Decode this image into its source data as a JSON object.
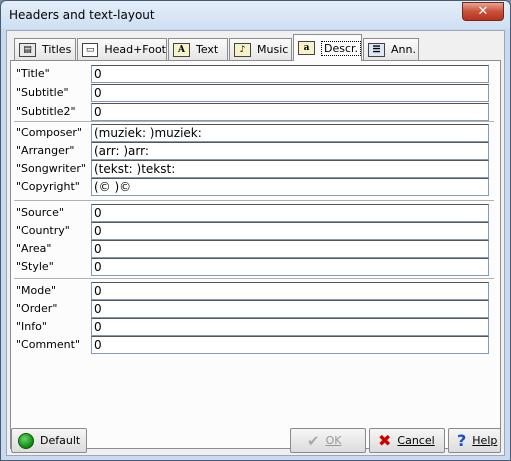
{
  "window": {
    "title": "Headers and text-layout",
    "close_symbol": "✕"
  },
  "tabs": [
    {
      "label": "Titles",
      "icon": "titles-icon"
    },
    {
      "label": "Head+Foot",
      "icon": "head-foot-icon"
    },
    {
      "label": "Text",
      "icon": "text-a-icon",
      "glyph": "A"
    },
    {
      "label": "Music",
      "icon": "music-icon",
      "glyph": "♪"
    },
    {
      "label": "Descr.",
      "icon": "descr-icon",
      "glyph": "a",
      "active": true
    },
    {
      "label": "Ann.",
      "icon": "ann-icon"
    }
  ],
  "groups": [
    {
      "rows": [
        {
          "label": "\"Title\"",
          "value": "0"
        },
        {
          "label": "\"Subtitle\"",
          "value": "0"
        },
        {
          "label": "\"Subtitle2\"",
          "value": "0"
        }
      ]
    },
    {
      "rows": [
        {
          "label": "\"Composer\"",
          "value": "(muziek: )muziek:"
        },
        {
          "label": "\"Arranger\"",
          "value": "(arr: )arr:"
        },
        {
          "label": "\"Songwriter\"",
          "value": "(tekst: )tekst:"
        },
        {
          "label": "\"Copyright\"",
          "value": "(© )©"
        }
      ]
    },
    {
      "rows": [
        {
          "label": "\"Source\"",
          "value": "0"
        },
        {
          "label": "\"Country\"",
          "value": "0"
        },
        {
          "label": "\"Area\"",
          "value": "0"
        },
        {
          "label": "\"Style\"",
          "value": "0"
        }
      ]
    },
    {
      "rows": [
        {
          "label": "\"Mode\"",
          "value": "0"
        },
        {
          "label": "\"Order\"",
          "value": "0"
        },
        {
          "label": "\"Info\"",
          "value": "0"
        },
        {
          "label": "\"Comment\"",
          "value": "0"
        }
      ]
    }
  ],
  "buttons": {
    "default_label": "Default",
    "ok_label": "OK",
    "ok_enabled": false,
    "cancel_label": "Cancel",
    "help_label": "Help"
  },
  "colors": {
    "title_bar": "#cfdff3",
    "close_button": "#c9503a",
    "default_icon": "#0c8a0c",
    "cancel_icon": "#cc0000",
    "help_icon": "#1a50c8"
  }
}
